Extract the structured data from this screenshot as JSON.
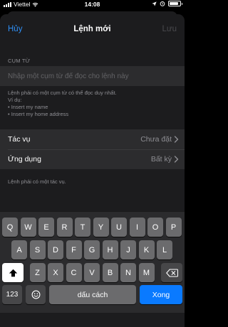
{
  "status_bar": {
    "carrier": "Viettel",
    "time": "14:08",
    "battery_level": 0.85
  },
  "nav": {
    "cancel": "Hủy",
    "title": "Lệnh mới",
    "save": "Lưu"
  },
  "phrase": {
    "section_header": "CỤM TỪ",
    "placeholder": "Nhập một cụm từ để đọc cho lệnh này",
    "value": "",
    "footnote": [
      "Lệnh phải có một cụm từ có thể đọc duy nhất.",
      "Ví dụ:",
      "• Insert my name",
      "• Insert my home address"
    ]
  },
  "rows": [
    {
      "label": "Tác vụ",
      "value": "Chưa đặt"
    },
    {
      "label": "Ứng dụng",
      "value": "Bất kỳ"
    }
  ],
  "action_note": "Lệnh phải có một tác vụ.",
  "keyboard": {
    "row1": [
      "Q",
      "W",
      "E",
      "R",
      "T",
      "Y",
      "U",
      "I",
      "O",
      "P"
    ],
    "row2": [
      "A",
      "S",
      "D",
      "F",
      "G",
      "H",
      "J",
      "K",
      "L"
    ],
    "row3": [
      "Z",
      "X",
      "C",
      "V",
      "B",
      "N",
      "M"
    ],
    "numbers_key": "123",
    "space_key": "dấu cách",
    "return_key": "Xong",
    "icons": {
      "shift": "shift-icon",
      "delete": "delete-icon",
      "emoji": "emoji-icon",
      "mic": "mic-icon"
    }
  },
  "colors": {
    "accent": "#2f8ff5",
    "return_key": "#0a7aff"
  }
}
